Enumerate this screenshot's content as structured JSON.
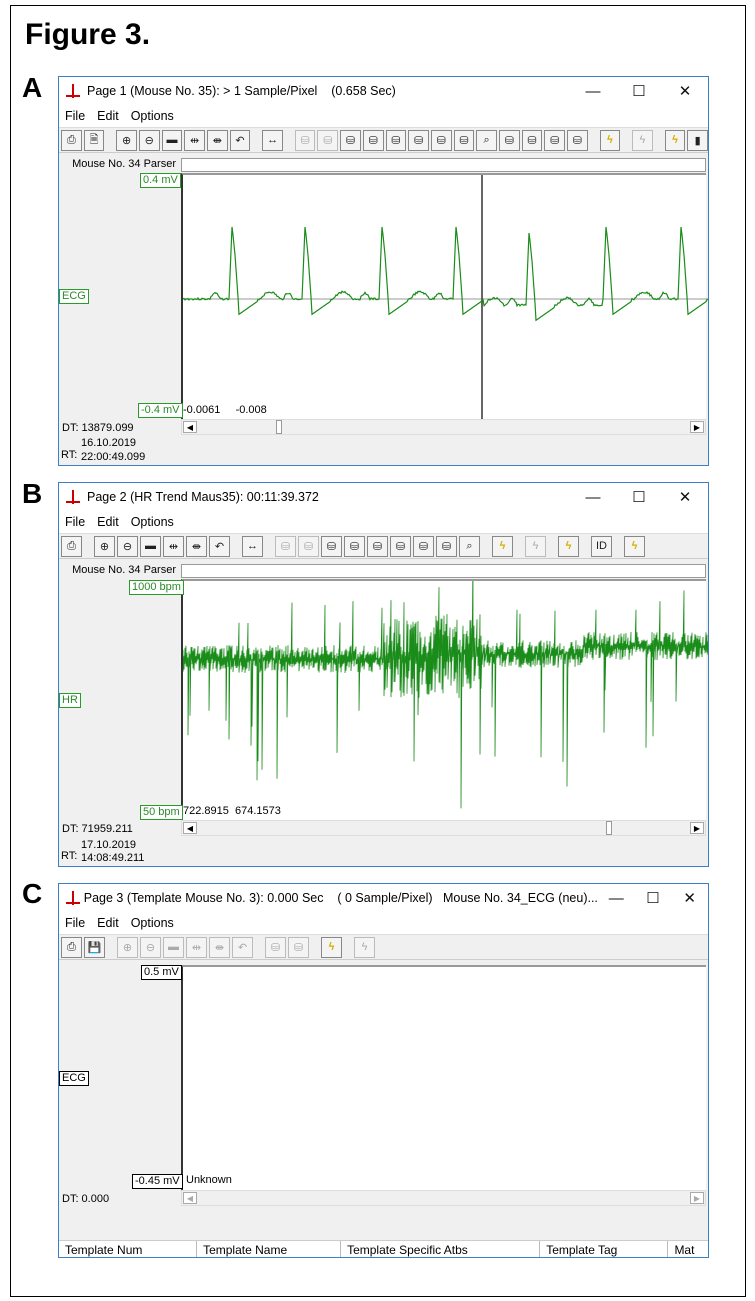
{
  "figure_title": "Figure 3.",
  "panels": {
    "A": {
      "letter": "A",
      "title": "Page 1 (Mouse No. 35): > 1 Sample/Pixel    (0.658 Sec)",
      "menu": [
        "File",
        "Edit",
        "Options"
      ],
      "toolbar": [
        "printer-icon",
        "document-icon",
        "|",
        "zoom-in-icon",
        "zoom-out-icon",
        "fit-icon",
        "expand-icon",
        "compress-icon",
        "undo-icon",
        "|",
        "horizontal-arrows-icon",
        "|",
        "find-prev-disabled-icon",
        "find-next-disabled-icon",
        "find-mail-prev-icon",
        "find-mail-next-icon",
        "binoculars-1-icon",
        "binoculars-2-icon",
        "binoculars-3-icon",
        "binoculars-4-icon",
        "search-clock-icon",
        "binoculars-red-1-icon",
        "binoculars-red-2-icon",
        "binoculars-dash-1-icon",
        "binoculars-dash-2-icon",
        "|",
        "lightning-icon",
        "|",
        "lightning-disabled-icon",
        "|",
        "lightning-marker-icon",
        "more-icon"
      ],
      "parser": "Mouse No. 34 Parser",
      "ymax": "0.4 mV",
      "channel": "ECG",
      "ymin": "-0.4 mV",
      "cursor_values": "-0.0061     -0.008",
      "dt": "DT: 13879.099",
      "rt_label": "RT:",
      "rt_date": "16.10.2019",
      "rt_time": "22:00:49.099",
      "scroll_pos": 0.19
    },
    "B": {
      "letter": "B",
      "title": "Page 2 (HR Trend Maus35): 00:11:39.372",
      "menu": [
        "File",
        "Edit",
        "Options"
      ],
      "toolbar": [
        "printer-icon",
        "|",
        "zoom-in-icon",
        "zoom-out-icon",
        "fit-icon",
        "expand-icon",
        "compress-icon",
        "undo-icon",
        "|",
        "horizontal-arrows-icon",
        "|",
        "find-prev-disabled-icon",
        "find-next-disabled-icon",
        "find-mail-prev-icon",
        "find-mail-next-icon",
        "binoculars-1-icon",
        "binoculars-2-icon",
        "binoculars-3-icon",
        "binoculars-4-icon",
        "search-clock-icon",
        "|",
        "lightning-icon",
        "|",
        "lightning-disabled-icon",
        "|",
        "lightning-marker-icon",
        "|",
        "id-icon",
        "|",
        "lightning-marker-green-icon"
      ],
      "parser": "Mouse No. 34 Parser",
      "ymax": "1000 bpm",
      "channel": "HR",
      "ymin": "50 bpm",
      "cursor_values": "722.8915  674.1573",
      "dt": "DT: 71959.211",
      "rt_label": "RT:",
      "rt_date": "17.10.2019",
      "rt_time": "14:08:49.211",
      "scroll_pos": 0.81
    },
    "C": {
      "letter": "C",
      "title": "Page 3 (Template Mouse No. 3): 0.000 Sec    ( 0 Sample/Pixel)   Mouse No. 34_ECG (neu)...",
      "menu": [
        "File",
        "Edit",
        "Options"
      ],
      "toolbar": [
        "printer-icon",
        "save-icon",
        "|",
        "zoom-in-disabled-icon",
        "zoom-out-disabled-icon",
        "fit-disabled-icon",
        "expand-disabled-icon",
        "compress-disabled-icon",
        "undo-disabled-icon",
        "|",
        "find-prev-disabled-icon",
        "find-next-disabled-icon",
        "|",
        "lightning-icon",
        "|",
        "lightning-disabled-icon"
      ],
      "ymax": "0.5 mV",
      "channel": "ECG",
      "ymin": "-0.45 mV",
      "cursor_values": "Unknown",
      "dt": "DT:   0.000",
      "columns": [
        "Template Num",
        "Template Name",
        "Template Specific Atbs",
        "Template Tag",
        "Mat"
      ]
    }
  },
  "window_buttons": {
    "minimize": "—",
    "maximize": "☐",
    "close": "✕"
  },
  "colors": {
    "trace": "#1a8c1a",
    "border": "#3b7fc4"
  }
}
